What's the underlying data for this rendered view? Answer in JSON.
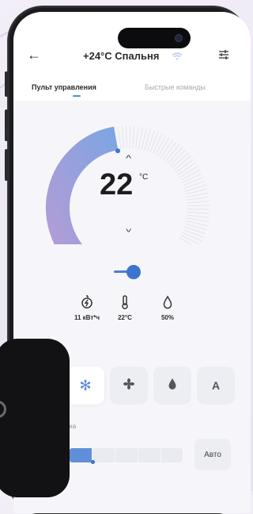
{
  "header": {
    "title": "+24°C Спальня"
  },
  "tabs": [
    {
      "label": "Пульт управления"
    },
    {
      "label": "Быстрые команды"
    }
  ],
  "dial": {
    "temperature": "22",
    "unit": "°C",
    "progress": 0.5
  },
  "stats": [
    {
      "icon": "energy-icon",
      "value": "11 кВт*ч"
    },
    {
      "icon": "thermometer-icon",
      "value": "22°C"
    },
    {
      "icon": "humidity-icon",
      "value": "50%"
    }
  ],
  "modes": [
    {
      "icon": "snowflake-icon",
      "active": true
    },
    {
      "icon": "fan-icon",
      "active": false
    },
    {
      "icon": "drop-icon",
      "active": false
    },
    {
      "icon": "auto-mode-icon",
      "label": "A",
      "active": false
    }
  ],
  "airflow": {
    "label_visible": "тока",
    "level": 0.2,
    "auto_label": "Авто"
  },
  "colors": {
    "accent": "#3d74cf",
    "arc_start": "#a79bd3",
    "arc_end": "#7aa1e1"
  }
}
